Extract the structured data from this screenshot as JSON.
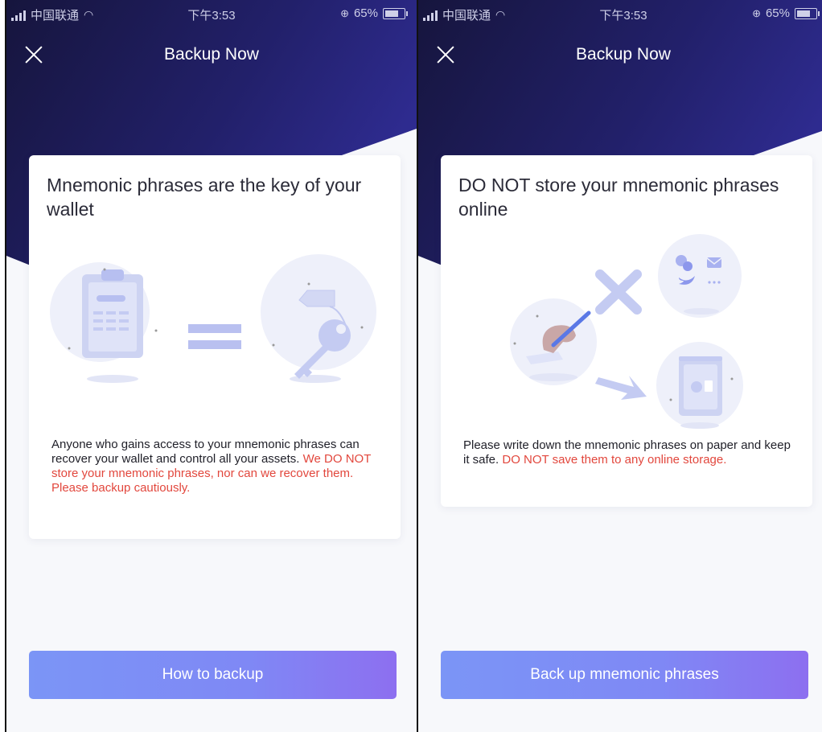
{
  "status_bar": {
    "carrier": "中国联通",
    "time": "下午3:53",
    "battery": "65%"
  },
  "screens": [
    {
      "nav_title": "Backup Now",
      "card": {
        "title": "Mnemonic phrases are the key of your wallet",
        "body": "Anyone who gains access to your mnemonic phrases can recover your wallet and control all your assets.",
        "warning": "We DO NOT store your mnemonic phrases, nor can we recover them. Please backup cautiously."
      },
      "button": "How to backup"
    },
    {
      "nav_title": "Backup Now",
      "card": {
        "title": "DO NOT store your mnemonic phrases online",
        "body": "Please write down the mnemonic phrases on paper and keep it safe.",
        "warning": "DO NOT save them to any online storage."
      },
      "button": "Back up mnemonic phrases"
    }
  ],
  "icons": {
    "left_illustration": [
      "clipboard-icon",
      "equals-icon",
      "key-icon"
    ],
    "right_illustration": [
      "writing-hand-icon",
      "cross-icon",
      "social-icon",
      "arrow-icon",
      "safe-icon"
    ]
  },
  "colors": {
    "header_dark": "#1c1a48",
    "header_purple": "#2c2a86",
    "warning": "#e2473d",
    "button_start": "#7b95f6",
    "button_end": "#8d6ff0"
  }
}
